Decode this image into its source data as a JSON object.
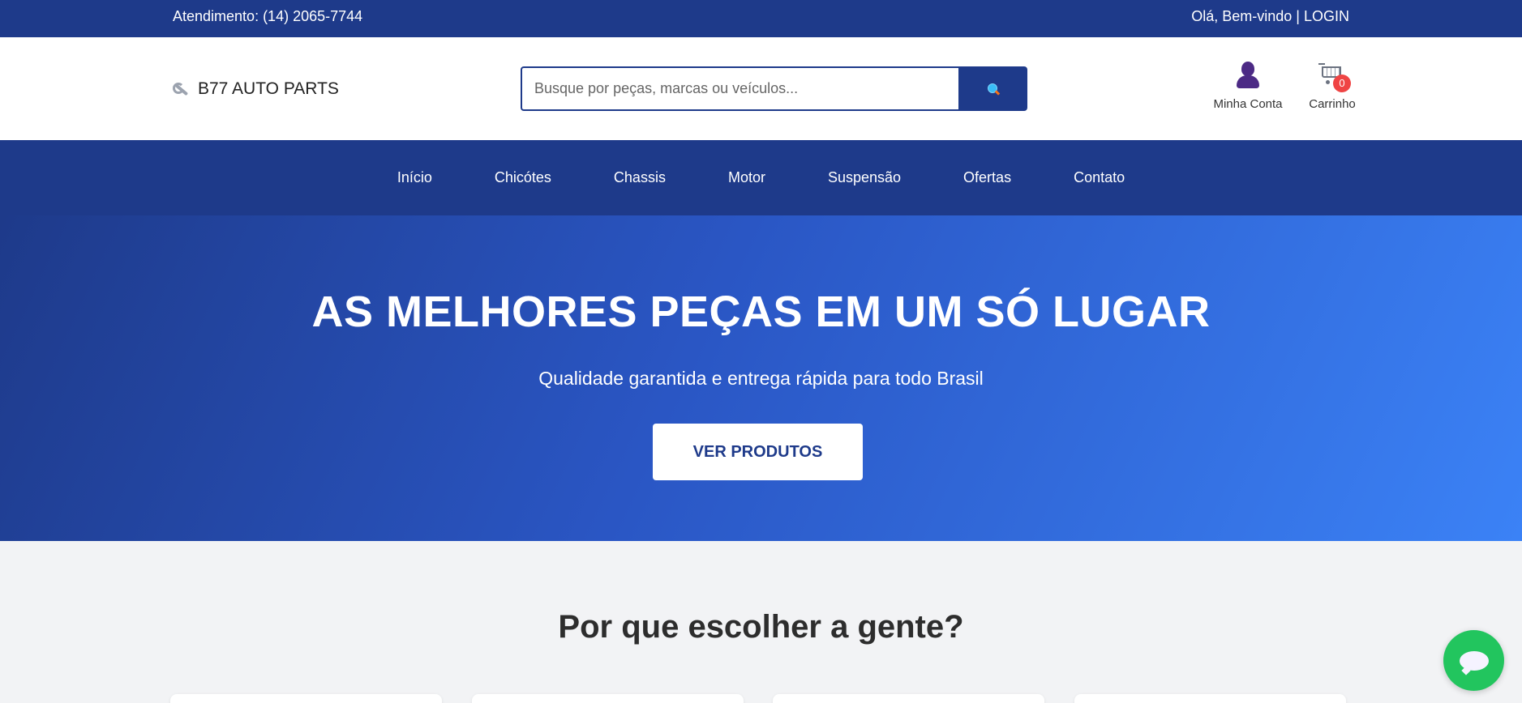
{
  "topbar": {
    "contact": "Atendimento: (14) 2065-7744",
    "greeting": "Olá, Bem-vindo | LOGIN"
  },
  "header": {
    "logo_text": "B77 AUTO PARTS",
    "logo_icon": "wrench-icon",
    "search": {
      "placeholder": "Busque por peças, marcas ou veículos...",
      "value": "",
      "button_icon": "search-icon"
    },
    "account": {
      "label": "Minha Conta",
      "icon": "user-icon"
    },
    "cart": {
      "label": "Carrinho",
      "icon": "cart-icon",
      "count": "0"
    }
  },
  "nav": {
    "items": [
      {
        "label": "Início"
      },
      {
        "label": "Chicótes"
      },
      {
        "label": "Chassis"
      },
      {
        "label": "Motor"
      },
      {
        "label": "Suspensão"
      },
      {
        "label": "Ofertas"
      },
      {
        "label": "Contato"
      }
    ]
  },
  "hero": {
    "title": "AS MELHORES PEÇAS EM UM SÓ LUGAR",
    "subtitle": "Qualidade garantida e entrega rápida para todo Brasil",
    "cta_label": "VER PRODUTOS"
  },
  "why": {
    "title": "Por que escolher a gente?"
  },
  "chat": {
    "icon": "chat-bubble-icon"
  },
  "colors": {
    "primary": "#1e3a8a",
    "hero_gradient_end": "#3b82f6",
    "badge": "#ef4444",
    "chat": "#22c55e"
  }
}
